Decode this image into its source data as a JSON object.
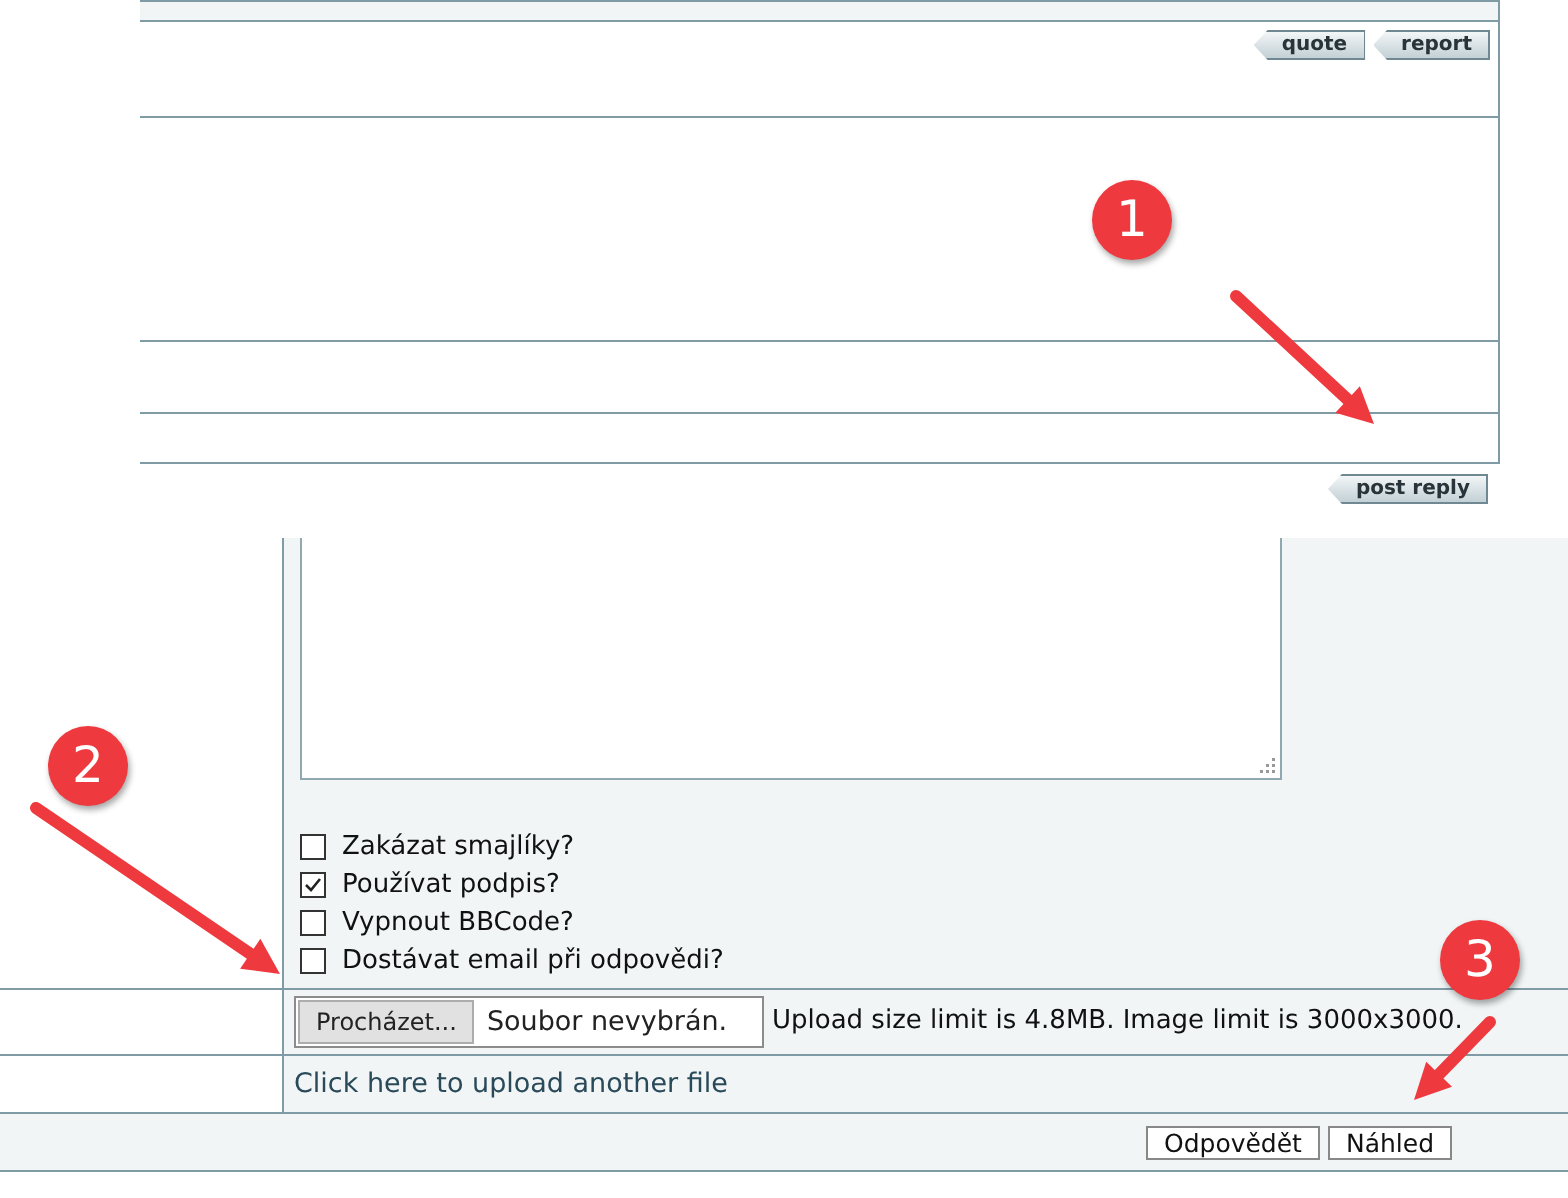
{
  "post_buttons": [
    "quote",
    "report"
  ],
  "post_reply_button": "post reply",
  "options": [
    {
      "label": "Zakázat smajlíky?",
      "checked": false
    },
    {
      "label": "Používat podpis?",
      "checked": true
    },
    {
      "label": "Vypnout BBCode?",
      "checked": false
    },
    {
      "label": "Dostávat email při odpovědi?",
      "checked": false
    }
  ],
  "file_input": {
    "button": "Procházet...",
    "value": "Soubor nevybrán.",
    "note": "Upload size limit is 4.8MB. Image limit is 3000x3000."
  },
  "upload_link": "Click here to upload another file",
  "buttons": [
    "Odpovědět",
    "Náhled"
  ],
  "annotations": [
    {
      "label": "1"
    },
    {
      "label": "2"
    },
    {
      "label": "3"
    }
  ]
}
